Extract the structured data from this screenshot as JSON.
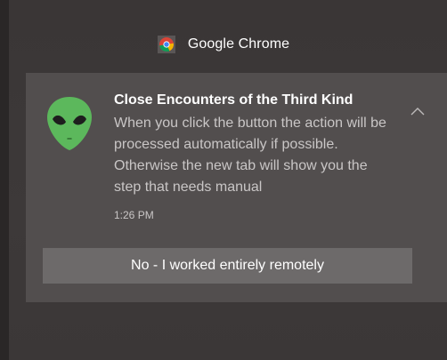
{
  "app": {
    "name": "Google Chrome",
    "icon": "chrome-icon"
  },
  "notification": {
    "avatar_icon": "alien-icon",
    "title": "Close Encounters of the Third Kind",
    "body": "When you click the button the action will be processed automatically if possible. Otherwise the new tab will show you the step that needs manual",
    "time": "1:26 PM",
    "collapse_icon": "chevron-up-icon",
    "action_label": "No - I worked entirely remotely"
  },
  "colors": {
    "background": "#3c3838",
    "toast": "#524e4e",
    "button": "#6d6a6a",
    "alien": "#5cb85c",
    "text_primary": "#ffffff",
    "text_secondary": "#c9c6c6"
  }
}
